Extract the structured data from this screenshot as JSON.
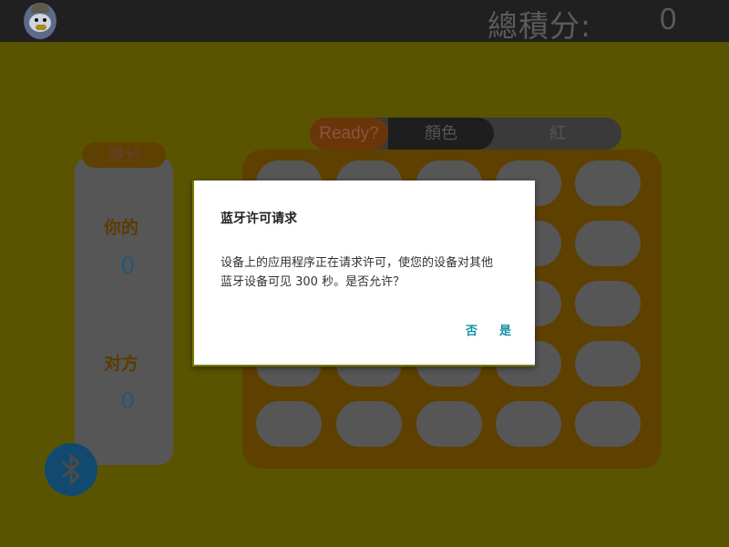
{
  "header": {
    "total_label": "總積分:",
    "total_value": "0",
    "logo_icon": "duck-avatar-icon"
  },
  "score": {
    "tab_label": "得分",
    "you_label": "你的",
    "you_value": "0",
    "opponent_label": "对方",
    "opponent_value": "0"
  },
  "status_bar": {
    "ready_label": "Ready?",
    "color_label": "顏色",
    "color_value": "紅"
  },
  "board": {
    "rows": 5,
    "cols": 5
  },
  "bluetooth_button": {
    "icon": "bluetooth-icon"
  },
  "dialog": {
    "title": "蓝牙许可请求",
    "message_line1": "设备上的应用程序正在请求许可，使您的设备对其他",
    "message_line2": "蓝牙设备可见 300 秒。是否允许？",
    "deny_label": "否",
    "allow_label": "是"
  },
  "colors": {
    "dim_background": "#5a5400",
    "accent": "#138fa8",
    "topbar": "#202020"
  }
}
